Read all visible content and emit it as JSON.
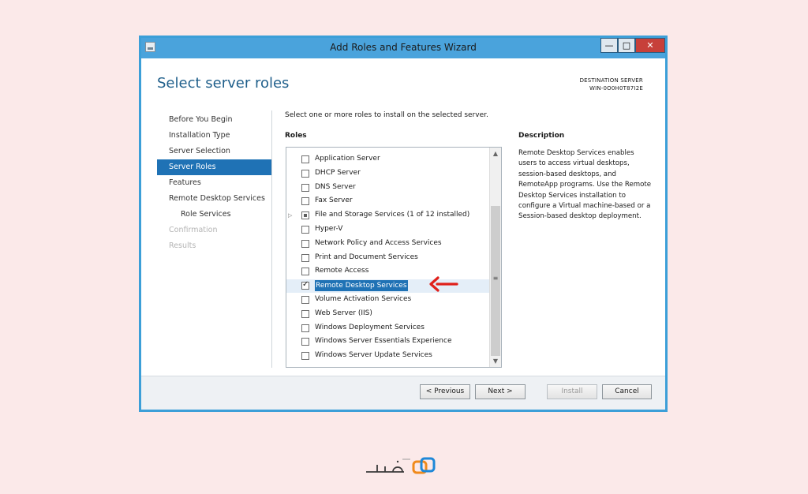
{
  "window": {
    "title": "Add Roles and Features Wizard",
    "min_glyph": "—",
    "max_glyph": "□",
    "close_glyph": "✕"
  },
  "page": {
    "title": "Select server roles",
    "destination_label": "DESTINATION SERVER",
    "destination_server": "WIN-0O0H0T87I2E"
  },
  "nav": {
    "items": [
      {
        "label": "Before You Begin",
        "state": "normal"
      },
      {
        "label": "Installation Type",
        "state": "normal"
      },
      {
        "label": "Server Selection",
        "state": "normal"
      },
      {
        "label": "Server Roles",
        "state": "active"
      },
      {
        "label": "Features",
        "state": "normal"
      },
      {
        "label": "Remote Desktop Services",
        "state": "normal"
      },
      {
        "label": "Role Services",
        "state": "sub"
      },
      {
        "label": "Confirmation",
        "state": "disabled"
      },
      {
        "label": "Results",
        "state": "disabled"
      }
    ]
  },
  "main": {
    "instruction": "Select one or more roles to install on the selected server.",
    "roles_header": "Roles",
    "roles": [
      {
        "label": "Application Server",
        "state": "unchecked"
      },
      {
        "label": "DHCP Server",
        "state": "unchecked"
      },
      {
        "label": "DNS Server",
        "state": "unchecked"
      },
      {
        "label": "Fax Server",
        "state": "unchecked"
      },
      {
        "label": "File and Storage Services (1 of 12 installed)",
        "state": "partial"
      },
      {
        "label": "Hyper-V",
        "state": "unchecked"
      },
      {
        "label": "Network Policy and Access Services",
        "state": "unchecked"
      },
      {
        "label": "Print and Document Services",
        "state": "unchecked"
      },
      {
        "label": "Remote Access",
        "state": "unchecked"
      },
      {
        "label": "Remote Desktop Services",
        "state": "checked"
      },
      {
        "label": "Volume Activation Services",
        "state": "unchecked"
      },
      {
        "label": "Web Server (IIS)",
        "state": "unchecked"
      },
      {
        "label": "Windows Deployment Services",
        "state": "unchecked"
      },
      {
        "label": "Windows Server Essentials Experience",
        "state": "unchecked"
      },
      {
        "label": "Windows Server Update Services",
        "state": "unchecked"
      }
    ],
    "description_header": "Description",
    "description_text": "Remote Desktop Services enables users to access virtual desktops, session-based desktops, and RemoteApp programs. Use the Remote Desktop Services installation to configure a Virtual machine-based or a Session-based desktop deployment."
  },
  "footer": {
    "previous": "< Previous",
    "next": "Next >",
    "install": "Install",
    "cancel": "Cancel"
  },
  "colors": {
    "titlebar": "#4aa3dc",
    "accent": "#1f72b5",
    "annotation_arrow": "#e0201b",
    "close_button": "#c7403a"
  }
}
